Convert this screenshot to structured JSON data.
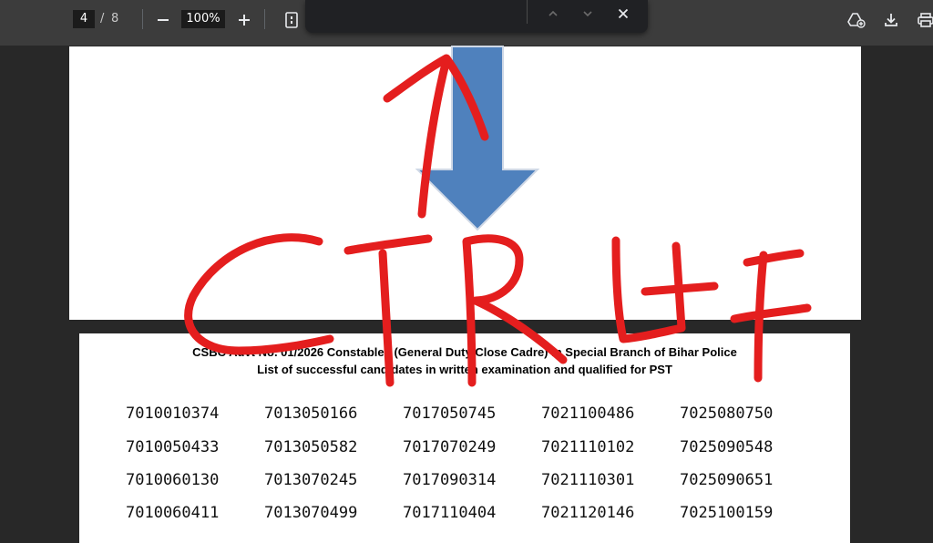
{
  "toolbar": {
    "current_page": "4",
    "page_separator": "/",
    "total_pages": "8",
    "zoom_level": "100%",
    "icons": [
      "zoom-out-icon",
      "zoom-in-icon",
      "fit-page-icon",
      "add-to-drive-icon",
      "download-icon",
      "print-icon"
    ]
  },
  "find_bar": {
    "value": "",
    "icons": [
      "previous-result-icon",
      "next-result-icon",
      "close-icon"
    ]
  },
  "annotation": {
    "handwritten_text": "CTRL+F",
    "stroke_color": "#e41e1e",
    "arrow_color": "#4f81bd"
  },
  "document": {
    "title_line1": "CSBC Advt No. 01/2026 Constables (General Duty Close Cadre) in Special Branch of Bihar Police",
    "title_line2": "List of successful candidates in written examination and qualified for PST",
    "rows": [
      [
        "7010010374",
        "7013050166",
        "7017050745",
        "7021100486",
        "7025080750"
      ],
      [
        "7010050433",
        "7013050582",
        "7017070249",
        "7021110102",
        "7025090548"
      ],
      [
        "7010060130",
        "7013070245",
        "7017090314",
        "7021110301",
        "7025090651"
      ],
      [
        "7010060411",
        "7013070499",
        "7017110404",
        "7021120146",
        "7025100159"
      ]
    ]
  }
}
